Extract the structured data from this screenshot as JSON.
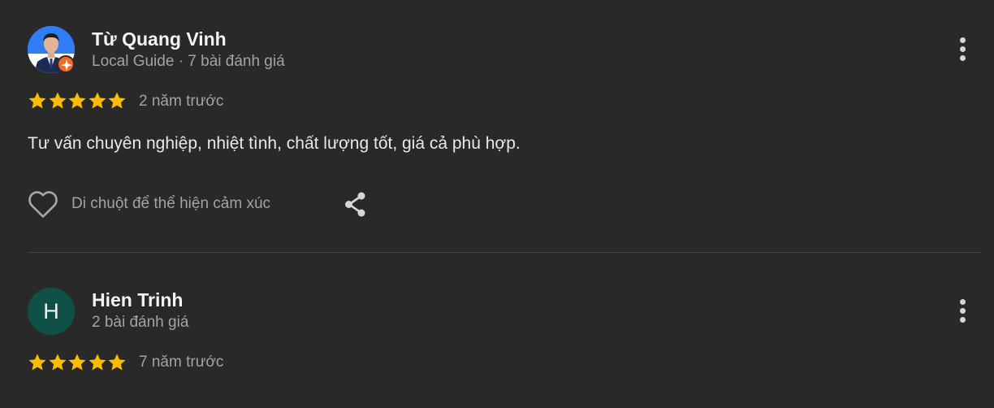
{
  "colors": {
    "background": "#292929",
    "star": "#fbbc04",
    "avatar_bg_2": "#0f5147",
    "guide_badge": "#f26a24"
  },
  "reviews": [
    {
      "name": "Từ Quang Vinh",
      "meta": "Local Guide · 7 bài đánh giá",
      "rating": 5,
      "time": "2 năm trước",
      "text": "Tư vấn chuyên nghiệp, nhiệt tình, chất lượng tốt, giá cả phù hợp.",
      "reaction_label": "Di chuột để thể hiện cảm xúc",
      "avatar": "photo",
      "icons": {
        "badge": "local-guide-badge-icon",
        "react": "heart-icon",
        "share": "share-icon",
        "menu": "more-vert-icon"
      }
    },
    {
      "name": "Hien Trinh",
      "meta": "2 bài đánh giá",
      "rating": 5,
      "time": "7 năm trước",
      "avatar_letter": "H",
      "icons": {
        "menu": "more-vert-icon"
      }
    }
  ]
}
